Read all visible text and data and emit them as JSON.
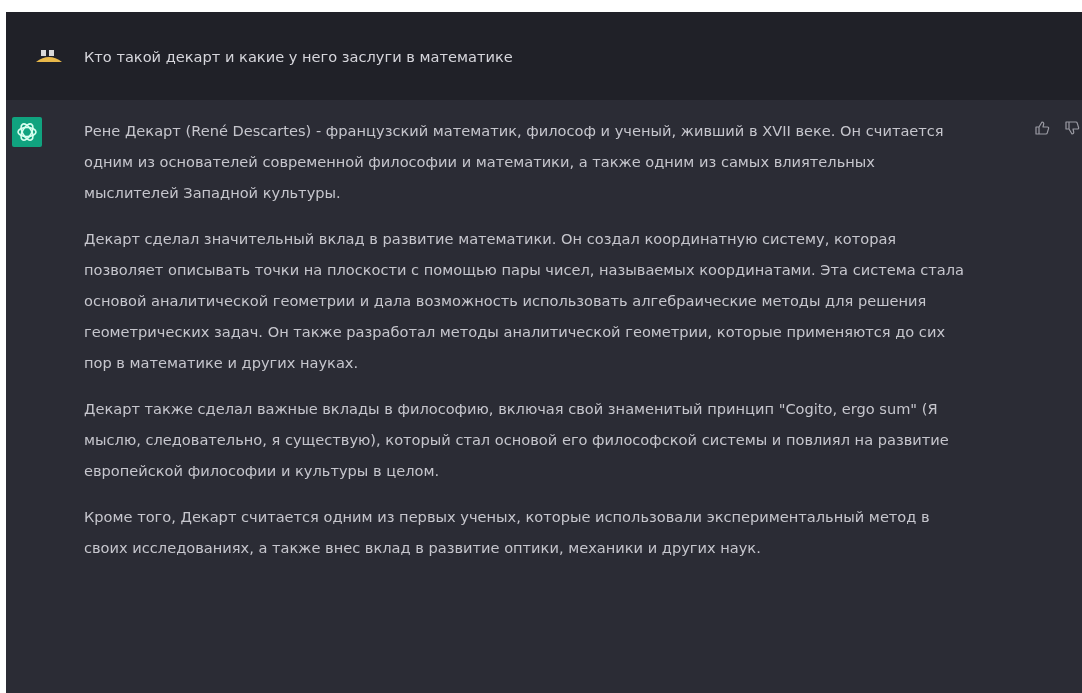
{
  "messages": [
    {
      "kind": "user",
      "paragraphs": [
        "Кто такой декарт и какие у него заслуги в математике"
      ]
    },
    {
      "kind": "assistant",
      "paragraphs": [
        "Рене Декарт (René Descartes) - французский математик, философ и ученый, живший в XVII веке. Он считается одним из основателей современной философии и математики, а также одним из самых влиятельных мыслителей Западной культуры.",
        "Декарт сделал значительный вклад в развитие математики. Он создал координатную систему, которая позволяет описывать точки на плоскости с помощью пары чисел, называемых координатами. Эта система стала основой аналитической геометрии и дала возможность использовать алгебраические методы для решения геометрических задач. Он также разработал методы аналитической геометрии, которые применяются до сих пор в математике и других науках.",
        "Декарт также сделал важные вклады в философию, включая свой знаменитый принцип \"Cogito, ergo sum\" (Я мыслю, следовательно, я существую), который стал основой его философской системы и повлиял на развитие европейской философии и культуры в целом.",
        "Кроме того, Декарт считается одним из первых ученых, которые использовали экспериментальный метод в своих исследованиях, а также внес вклад в развитие оптики, механики и других наук."
      ]
    }
  ]
}
